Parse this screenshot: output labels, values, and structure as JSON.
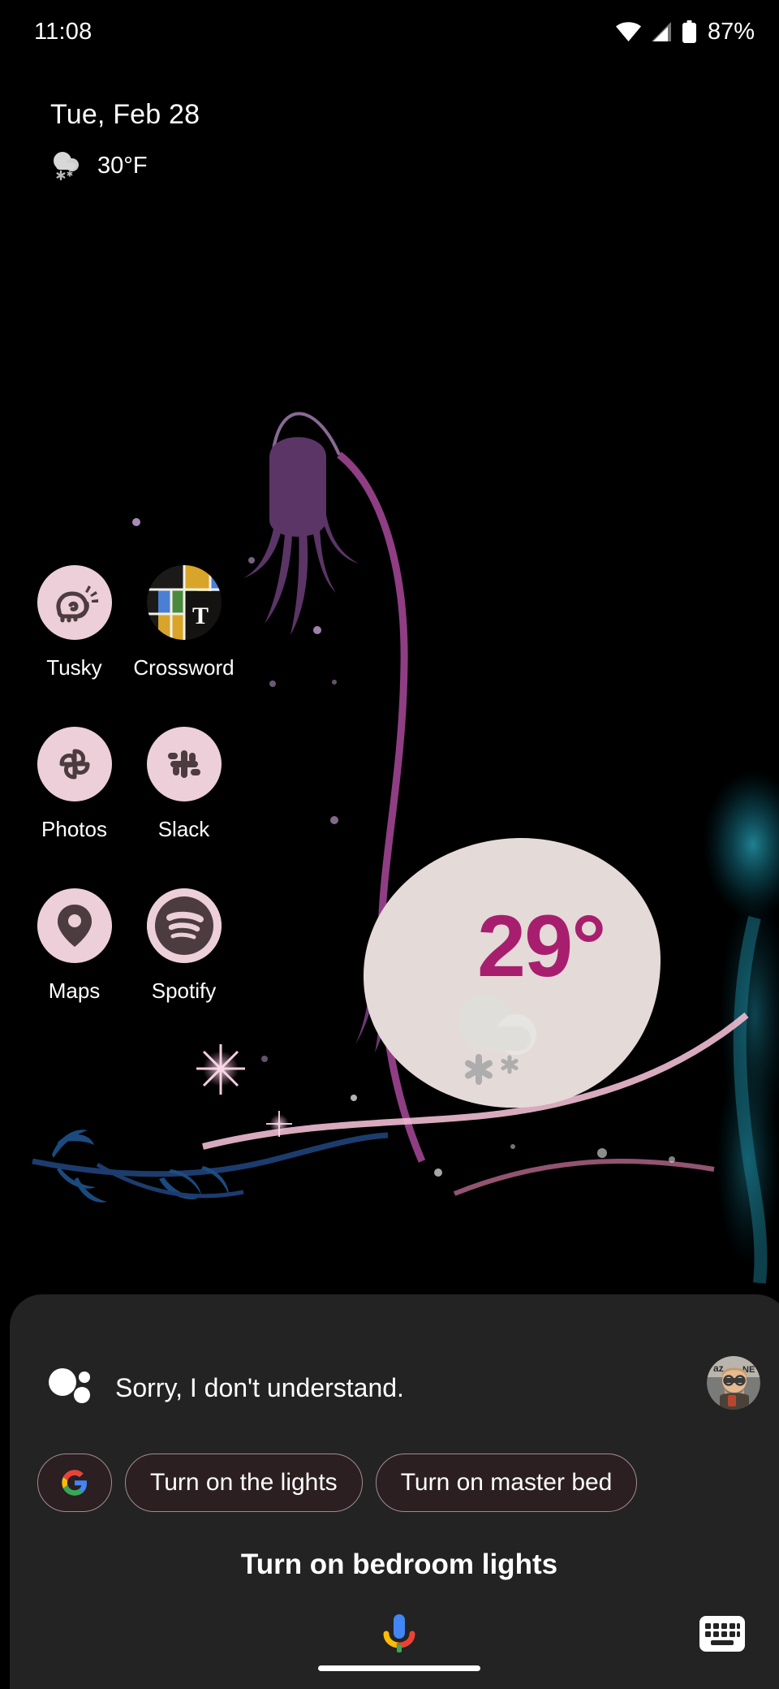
{
  "status_bar": {
    "time": "11:08",
    "battery_percent": "87%",
    "icons": [
      "wifi-icon",
      "cellular-signal-icon",
      "battery-icon"
    ]
  },
  "at_a_glance": {
    "date": "Tue, Feb 28",
    "temperature": "30°F",
    "weather_icon": "snow-cloud-icon"
  },
  "app_grid": {
    "rows": [
      [
        {
          "label": "Tusky",
          "icon": "tusky-icon"
        },
        {
          "label": "Crossword",
          "icon": "nyt-crossword-icon"
        }
      ],
      [
        {
          "label": "Photos",
          "icon": "google-photos-icon"
        },
        {
          "label": "Slack",
          "icon": "slack-icon"
        }
      ],
      [
        {
          "label": "Maps",
          "icon": "google-maps-icon"
        },
        {
          "label": "Spotify",
          "icon": "spotify-icon"
        }
      ]
    ]
  },
  "weather_widget": {
    "temperature": "29°",
    "icon": "snow-cloud-icon",
    "blob_color": "#e4dad8",
    "temp_color": "#a81e6e"
  },
  "assistant": {
    "response_text": "Sorry, I don't understand.",
    "assistant_icon": "google-assistant-dots-icon",
    "avatar": "user-avatar",
    "chips": [
      {
        "label": "",
        "icon": "google-g-icon"
      },
      {
        "label": "Turn on the lights",
        "icon": ""
      },
      {
        "label": "Turn on master bed",
        "icon": ""
      }
    ],
    "query_text": "Turn on bedroom lights",
    "mic_icon": "google-microphone-icon",
    "keyboard_icon": "keyboard-icon"
  },
  "navigation": {
    "home_indicator": "home-gesture-bar"
  },
  "colors": {
    "background": "#000000",
    "sheet": "#232323",
    "icon_pink": "#eccfd9",
    "icon_dark": "#4c3c40",
    "accent_magenta": "#a81e6e"
  }
}
